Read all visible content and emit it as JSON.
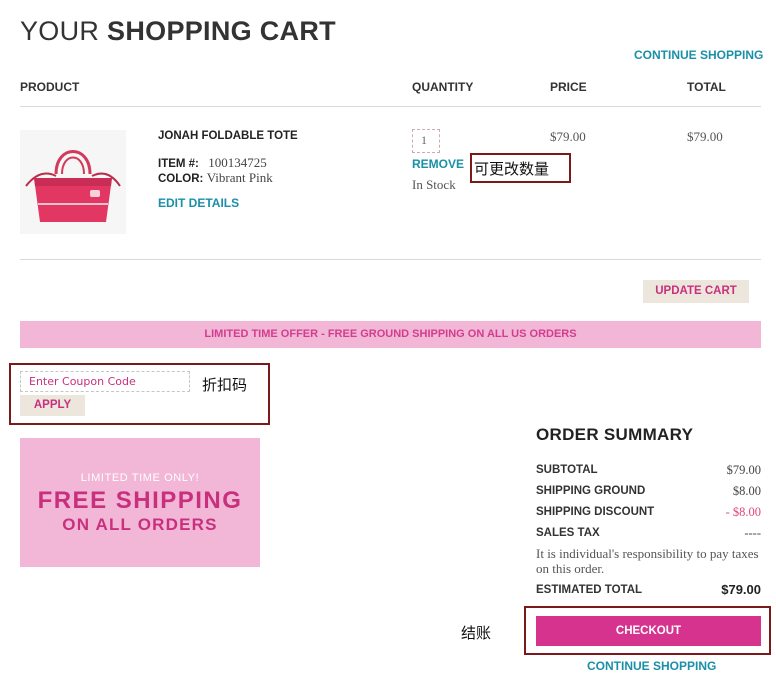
{
  "header": {
    "title_light": "YOUR",
    "title_bold": "SHOPPING CART",
    "continue_shopping": "CONTINUE SHOPPING"
  },
  "table": {
    "columns": [
      "PRODUCT",
      "QUANTITY",
      "PRICE",
      "TOTAL"
    ]
  },
  "item": {
    "name": "JONAH FOLDABLE TOTE",
    "item_label": "ITEM #:",
    "item_number": "100134725",
    "color_label": "COLOR:",
    "color_value": "Vibrant Pink",
    "edit_details": "EDIT DETAILS",
    "quantity": "1",
    "remove": "REMOVE",
    "stock": "In Stock",
    "price": "$79.00",
    "total": "$79.00",
    "product_color": "#e23763"
  },
  "annotations": {
    "quantity_note": "可更改数量",
    "coupon_note": "折扣码",
    "checkout_note": "结账"
  },
  "update_cart": "UPDATE CART",
  "promo_bar": "LIMITED TIME OFFER - FREE GROUND SHIPPING ON ALL US ORDERS",
  "coupon": {
    "placeholder": "Enter Coupon Code",
    "apply": "APPLY"
  },
  "banner": {
    "line1": "LIMITED TIME ONLY!",
    "line2": "FREE SHIPPING",
    "line3": "ON ALL ORDERS"
  },
  "summary": {
    "title": "ORDER SUMMARY",
    "subtotal_label": "SUBTOTAL",
    "subtotal_value": "$79.00",
    "shipping_label": "SHIPPING GROUND",
    "shipping_value": "$8.00",
    "discount_label": "SHIPPING DISCOUNT",
    "discount_value": "- $8.00",
    "tax_label": "SALES TAX",
    "tax_value": "----",
    "tax_note": "It is individual's responsibility to pay taxes on this order.",
    "estimated_label": "ESTIMATED TOTAL",
    "estimated_value": "$79.00",
    "checkout": "CHECKOUT",
    "continue_shopping": "CONTINUE SHOPPING"
  },
  "colors": {
    "accent_pink": "#d6338f",
    "promo_pink": "#f2b6d7",
    "link_teal": "#1a8fa8",
    "annotation_border": "#7b1a1a"
  }
}
